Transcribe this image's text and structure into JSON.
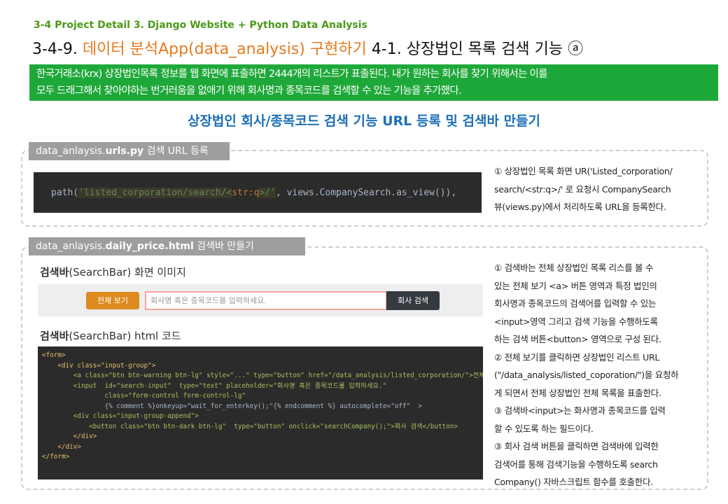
{
  "header": {
    "kicker": "3-4 Project Detail 3. Django Website + Python Data Analysis",
    "title_num": "3-4-9.",
    "title_orange1": "데이터 분석App(data_analysis)",
    "title_orange2": "구현하기",
    "title_rest": "4-1. 상장법인 목록 검색 기능 ⓐ"
  },
  "banner": {
    "line1": "한국거래소(krx) 상장법인목록 정보를 웹 화면에 표출하면 2444개의 리스트가 표출된다. 내가 원하는 회사를 찾기 위해서는 이를",
    "line2": "모두 드래그해서 찾아야하는 번거러움을 없애기 위해 회사명과 종목코드를 검색할 수 있는 기능을 추가했다."
  },
  "subtitle": "상장법인 회사/종목코드 검색 기능 URL 등록 및 검색바 만들기",
  "section1": {
    "tag_prefix": "data_anlaysis.",
    "tag_bold": "urls.py",
    "tag_suffix": " 검색 URL 등록",
    "code": {
      "pre": "path(",
      "q1": "'",
      "s1": "listed_corporation/search/<",
      "s2": "str:q",
      "s3": ">/",
      "q2": "'",
      "post": ", views.CompanySearch.as_view()),"
    },
    "desc": [
      "① 상장법인 목록 화면 UR('Listed_corporation/",
      "search/<str:q>/' 로 요청시 CompanySearch",
      "뷰(views.py)에서 처리하도록 URL을 등록한다."
    ]
  },
  "section2": {
    "tag_prefix": "data_anlaysis.",
    "tag_bold": "daily_price.html",
    "tag_suffix": " 검색바 만들기",
    "label1_bold": "검색바",
    "label1_rest": "(SearchBar) 화면 이미지",
    "label2_bold": "검색바",
    "label2_rest": "(SearchBar) html 코드",
    "searchbar": {
      "view_all": "전체 보기",
      "placeholder": "회사명 혹은 종목코드를 입력하세요.",
      "search": "회사 검색"
    },
    "code_lines": [
      "<form>",
      "    <div class=\"input-group\">",
      "        <a class=\"btn btn-warning btn-lg\" style=\"...\" type=\"button\" href=\"/data_analysis/listed_corporation/\">전체 보기</a>",
      "",
      "        <input  id=\"search-input\"  type=\"text\" placeholder=\"회사명 혹은 종목코드를 입력하세요.\"",
      "                class=\"form-control form-control-lg\"",
      "                {% comment %}onkeyup=\"wait_for_enterkey();\"{% endcomment %} autocomplete=\"off\"  >",
      "",
      "        <div class=\"input-group-append\">",
      "            <button class=\"btn btn-dark btn-lg\"  type=\"button\" onclick=\"searchCompany();\">회사 검색</button>",
      "        </div>",
      "    </div>",
      "</form>"
    ],
    "desc": [
      "① 검색바는 전체 상장법인 목록 리스를 볼 수",
      "있는 전체 보기 <a> 버튼 영역과 특정 법인의",
      "회사명과 종목코드의 검색어를 입력할 수 있는",
      "<input>영역 그리고 검색 기능을 수행하도록",
      "하는 검색 버튼<button> 영역으로 구성 된다.",
      "② 전체 보기를 클릭하면 상장법인 리스트 URL",
      "(\"/data_analysis/listed_coporation/\")을  요청하",
      "게 되면서 전체 상장법인 전체 목록을 표출한다.",
      "③ 검색바<input>는 화사명과 종목코드를 입력",
      "할 수 있도록 하는 필드이다.",
      "③ 회사 검색 버튼을 클릭하면 검색바에 입력한",
      "검색어를 통해 검색기능을 수행하도록 search",
      "Company() 자바스크립트 함수를 호출한다."
    ]
  }
}
